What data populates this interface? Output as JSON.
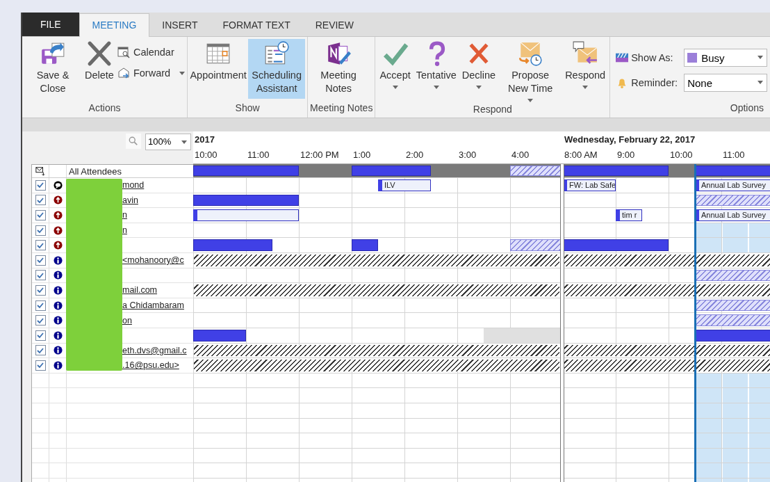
{
  "tabs": [
    {
      "label": "FILE",
      "kind": "file",
      "selected": false
    },
    {
      "label": "MEETING",
      "kind": "tab",
      "selected": true
    },
    {
      "label": "INSERT",
      "kind": "tab",
      "selected": false
    },
    {
      "label": "FORMAT TEXT",
      "kind": "tab",
      "selected": false
    },
    {
      "label": "REVIEW",
      "kind": "tab",
      "selected": false
    }
  ],
  "ribbon": {
    "actions": {
      "label": "Actions",
      "save": "Save & Close",
      "delete": "Delete",
      "calendar": "Calendar",
      "forward": "Forward"
    },
    "show": {
      "label": "Show",
      "items": [
        {
          "label": "Appointment",
          "selected": false
        },
        {
          "label": "Scheduling Assistant",
          "selected": true
        }
      ]
    },
    "notes": {
      "label": "Meeting Notes",
      "button": "Meeting Notes"
    },
    "respond": {
      "label": "Respond",
      "items": [
        {
          "label": "Accept"
        },
        {
          "label": "Tentative"
        },
        {
          "label": "Decline"
        },
        {
          "label": "Propose New Time"
        },
        {
          "label": "Respond"
        }
      ]
    },
    "options": {
      "label": "Options",
      "show_as_label": "Show As:",
      "show_as": "Busy",
      "reminder_label": "Reminder:",
      "reminder": "None"
    }
  },
  "zoom": {
    "value": "100%"
  },
  "schedule": {
    "days": [
      {
        "header": "2017",
        "hours": [
          "10:00",
          "11:00",
          "12:00 PM",
          "1:00",
          "2:00",
          "3:00",
          "4:00"
        ]
      },
      {
        "header": "Wednesday, February 22, 2017",
        "hours": [
          "8:00 AM",
          "9:00",
          "10:00",
          "11:00"
        ]
      }
    ],
    "timeline": [
      {
        "selected": false
      },
      {
        "selected": false
      },
      {
        "selected": false
      },
      {
        "selected": false
      },
      {
        "selected": false
      },
      {
        "selected": false
      },
      {
        "selected": false
      },
      {
        "selected": false
      },
      {
        "selected": false
      },
      {
        "selected": false
      },
      {
        "selected": false
      },
      {
        "selected": false
      },
      {
        "selected": false
      },
      {
        "selected": false
      },
      {
        "selected": false
      },
      {
        "selected": false
      },
      {
        "selected": false
      },
      {
        "selected": false
      },
      {
        "selected": false
      },
      {
        "selected": true
      },
      {
        "selected": true
      },
      {
        "selected": true
      }
    ],
    "all_attendees": {
      "label": "All Attendees",
      "slots": [
        {
          "kind": "busy"
        },
        {
          "kind": "busy"
        },
        {
          "kind": "busy"
        },
        {
          "kind": "busy"
        },
        {
          "kind": "free"
        },
        {
          "kind": "free"
        },
        {
          "kind": "busy"
        },
        {
          "kind": "busy"
        },
        {
          "kind": "busy"
        },
        {
          "kind": "free"
        },
        {
          "kind": "free"
        },
        {
          "kind": "free"
        },
        {
          "kind": "tentative"
        },
        {
          "kind": "tentative"
        },
        {
          "kind": "busy"
        },
        {
          "kind": "busy"
        },
        {
          "kind": "busy"
        },
        {
          "kind": "busy"
        },
        {
          "kind": "free"
        },
        {
          "kind": "busy"
        },
        {
          "kind": "busy"
        },
        {
          "kind": "busy"
        }
      ]
    },
    "attendees": [
      {
        "name": "mond",
        "kind": "organizer",
        "checked": true,
        "no_info": false,
        "slots": [
          {
            "kind": "free"
          },
          {
            "kind": "free"
          },
          {
            "kind": "free"
          },
          {
            "kind": "free"
          },
          {
            "kind": "free"
          },
          {
            "kind": "free"
          },
          {
            "kind": "free"
          },
          {
            "kind": "labeled",
            "label": "ILV"
          },
          {
            "kind": "labeled"
          },
          {
            "kind": "free"
          },
          {
            "kind": "free"
          },
          {
            "kind": "free"
          },
          {
            "kind": "free"
          },
          {
            "kind": "free"
          },
          {
            "kind": "labeled",
            "label": "FW: Lab Safe"
          },
          {
            "kind": "labeled"
          },
          {
            "kind": "free"
          },
          {
            "kind": "free"
          },
          {
            "kind": "free"
          },
          {
            "kind": "labeled",
            "label": "Annual Lab Survey"
          },
          {
            "kind": "labeled"
          },
          {
            "kind": "labeled"
          }
        ]
      },
      {
        "name": "avin",
        "kind": "required",
        "checked": true,
        "no_info": false,
        "slots": [
          {
            "kind": "busy"
          },
          {
            "kind": "busy"
          },
          {
            "kind": "busy"
          },
          {
            "kind": "busy"
          },
          {
            "kind": "free"
          },
          {
            "kind": "free"
          },
          {
            "kind": "free"
          },
          {
            "kind": "free"
          },
          {
            "kind": "free"
          },
          {
            "kind": "free"
          },
          {
            "kind": "free"
          },
          {
            "kind": "free"
          },
          {
            "kind": "free"
          },
          {
            "kind": "free"
          },
          {
            "kind": "free"
          },
          {
            "kind": "free"
          },
          {
            "kind": "free"
          },
          {
            "kind": "free"
          },
          {
            "kind": "free"
          },
          {
            "kind": "tentative"
          },
          {
            "kind": "tentative"
          },
          {
            "kind": "tentative"
          }
        ]
      },
      {
        "name": "n",
        "kind": "required",
        "checked": true,
        "no_info": false,
        "slots": [
          {
            "kind": "labeled"
          },
          {
            "kind": "labeled"
          },
          {
            "kind": "labeled"
          },
          {
            "kind": "labeled"
          },
          {
            "kind": "free"
          },
          {
            "kind": "free"
          },
          {
            "kind": "free"
          },
          {
            "kind": "free"
          },
          {
            "kind": "free"
          },
          {
            "kind": "free"
          },
          {
            "kind": "free"
          },
          {
            "kind": "free"
          },
          {
            "kind": "free"
          },
          {
            "kind": "free"
          },
          {
            "kind": "free"
          },
          {
            "kind": "free"
          },
          {
            "kind": "labeled",
            "label": "tim r"
          },
          {
            "kind": "free"
          },
          {
            "kind": "free"
          },
          {
            "kind": "labeled",
            "label": "Annual Lab Survey"
          },
          {
            "kind": "labeled"
          },
          {
            "kind": "labeled"
          }
        ]
      },
      {
        "name": "n",
        "kind": "required",
        "checked": true,
        "no_info": false
      },
      {
        "kind": "required",
        "checked": true,
        "no_info": false,
        "slots": [
          {
            "kind": "busy"
          },
          {
            "kind": "busy"
          },
          {
            "kind": "busy"
          },
          {
            "kind": "free"
          },
          {
            "kind": "free"
          },
          {
            "kind": "free"
          },
          {
            "kind": "busy"
          },
          {
            "kind": "free"
          },
          {
            "kind": "free"
          },
          {
            "kind": "free"
          },
          {
            "kind": "free"
          },
          {
            "kind": "free"
          },
          {
            "kind": "tentative"
          },
          {
            "kind": "tentative"
          },
          {
            "kind": "busy"
          },
          {
            "kind": "busy"
          },
          {
            "kind": "busy"
          },
          {
            "kind": "busy"
          },
          {
            "kind": "free"
          },
          {
            "kind": "free"
          },
          {
            "kind": "free"
          },
          {
            "kind": "free"
          }
        ]
      },
      {
        "name": "<mohanoory@c",
        "kind": "optional",
        "checked": true,
        "no_info": true
      },
      {
        "kind": "optional",
        "checked": true,
        "no_info": false,
        "slots": [
          {
            "kind": "free"
          },
          {
            "kind": "free"
          },
          {
            "kind": "free"
          },
          {
            "kind": "free"
          },
          {
            "kind": "free"
          },
          {
            "kind": "free"
          },
          {
            "kind": "free"
          },
          {
            "kind": "free"
          },
          {
            "kind": "free"
          },
          {
            "kind": "free"
          },
          {
            "kind": "free"
          },
          {
            "kind": "free"
          },
          {
            "kind": "free"
          },
          {
            "kind": "free"
          },
          {
            "kind": "free"
          },
          {
            "kind": "free"
          },
          {
            "kind": "free"
          },
          {
            "kind": "free"
          },
          {
            "kind": "free"
          },
          {
            "kind": "tentative"
          },
          {
            "kind": "tentative"
          },
          {
            "kind": "tentative"
          }
        ]
      },
      {
        "name": "mail.com",
        "kind": "optional",
        "checked": true,
        "no_info": true
      },
      {
        "name": "a Chidambaram",
        "kind": "optional",
        "checked": true,
        "no_info": false,
        "slots": [
          {
            "kind": "free"
          },
          {
            "kind": "free"
          },
          {
            "kind": "free"
          },
          {
            "kind": "free"
          },
          {
            "kind": "free"
          },
          {
            "kind": "free"
          },
          {
            "kind": "free"
          },
          {
            "kind": "free"
          },
          {
            "kind": "free"
          },
          {
            "kind": "free"
          },
          {
            "kind": "free"
          },
          {
            "kind": "free"
          },
          {
            "kind": "free"
          },
          {
            "kind": "free"
          },
          {
            "kind": "free"
          },
          {
            "kind": "free"
          },
          {
            "kind": "free"
          },
          {
            "kind": "free"
          },
          {
            "kind": "free"
          },
          {
            "kind": "tentative"
          },
          {
            "kind": "tentative"
          },
          {
            "kind": "tentative"
          }
        ]
      },
      {
        "name": "on",
        "kind": "optional",
        "checked": true,
        "no_info": false,
        "slots": [
          {
            "kind": "free"
          },
          {
            "kind": "free"
          },
          {
            "kind": "free"
          },
          {
            "kind": "free"
          },
          {
            "kind": "free"
          },
          {
            "kind": "free"
          },
          {
            "kind": "free"
          },
          {
            "kind": "free"
          },
          {
            "kind": "free"
          },
          {
            "kind": "free"
          },
          {
            "kind": "free"
          },
          {
            "kind": "free"
          },
          {
            "kind": "free"
          },
          {
            "kind": "free"
          },
          {
            "kind": "free"
          },
          {
            "kind": "free"
          },
          {
            "kind": "free"
          },
          {
            "kind": "free"
          },
          {
            "kind": "free"
          },
          {
            "kind": "tentative"
          },
          {
            "kind": "tentative"
          },
          {
            "kind": "tentative"
          }
        ]
      },
      {
        "kind": "optional",
        "checked": true,
        "no_info": false,
        "slots": [
          {
            "kind": "busy"
          },
          {
            "kind": "busy"
          },
          {
            "kind": "free"
          },
          {
            "kind": "free"
          },
          {
            "kind": "free"
          },
          {
            "kind": "free"
          },
          {
            "kind": "free"
          },
          {
            "kind": "free"
          },
          {
            "kind": "free"
          },
          {
            "kind": "free"
          },
          {
            "kind": "free"
          },
          {
            "kind": "unavailable"
          },
          {
            "kind": "unavailable"
          },
          {
            "kind": "unavailable"
          },
          {
            "kind": "free"
          },
          {
            "kind": "free"
          },
          {
            "kind": "free"
          },
          {
            "kind": "free"
          },
          {
            "kind": "free"
          },
          {
            "kind": "busy"
          },
          {
            "kind": "busy"
          },
          {
            "kind": "busy"
          }
        ]
      },
      {
        "name": "eth.dvs@gmail.c",
        "kind": "optional",
        "checked": true,
        "no_info": true
      },
      {
        "name": ".16@psu.edu>",
        "kind": "optional",
        "checked": true,
        "no_info": true
      }
    ]
  }
}
